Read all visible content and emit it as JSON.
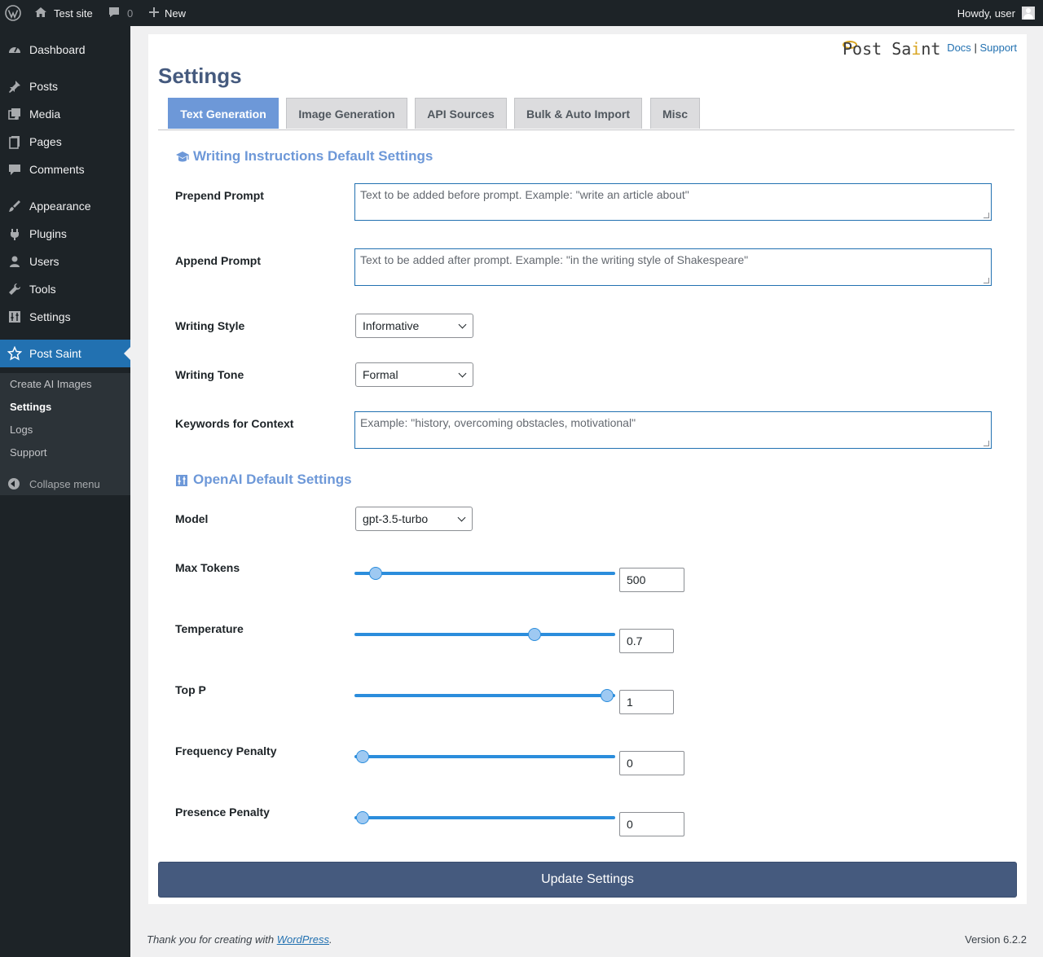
{
  "admin_bar": {
    "site_name": "Test site",
    "comments_count": "0",
    "new_label": "New",
    "howdy": "Howdy, user"
  },
  "sidebar": {
    "items": [
      {
        "label": "Dashboard",
        "icon": "dashboard-icon"
      },
      {
        "label": "Posts",
        "icon": "pin-icon"
      },
      {
        "label": "Media",
        "icon": "media-icon"
      },
      {
        "label": "Pages",
        "icon": "pages-icon"
      },
      {
        "label": "Comments",
        "icon": "comment-icon"
      },
      {
        "label": "Appearance",
        "icon": "brush-icon"
      },
      {
        "label": "Plugins",
        "icon": "plug-icon"
      },
      {
        "label": "Users",
        "icon": "user-icon"
      },
      {
        "label": "Tools",
        "icon": "wrench-icon"
      },
      {
        "label": "Settings",
        "icon": "sliders-icon"
      },
      {
        "label": "Post Saint",
        "icon": "star-icon"
      }
    ],
    "submenu": [
      "Create AI Images",
      "Settings",
      "Logs",
      "Support"
    ],
    "collapse": "Collapse menu"
  },
  "header": {
    "logo_a": "Post Sa",
    "logo_b": "i",
    "logo_c": "nt",
    "docs": "Docs",
    "sep": "|",
    "support": "Support",
    "title": "Settings"
  },
  "tabs": [
    "Text Generation",
    "Image Generation",
    "API Sources",
    "Bulk & Auto Import",
    "Misc"
  ],
  "writing": {
    "heading": "Writing Instructions Default Settings",
    "prepend_label": "Prepend Prompt",
    "prepend_placeholder": "Text to be added before prompt. Example: \"write an article about\"",
    "append_label": "Append Prompt",
    "append_placeholder": "Text to be added after prompt. Example: \"in the writing style of Shakespeare\"",
    "style_label": "Writing Style",
    "style_value": "Informative",
    "tone_label": "Writing Tone",
    "tone_value": "Formal",
    "keywords_label": "Keywords for Context",
    "keywords_placeholder": "Example: \"history, overcoming obstacles, motivational\""
  },
  "openai": {
    "heading": "OpenAI Default Settings",
    "model_label": "Model",
    "model_value": "gpt-3.5-turbo",
    "max_tokens_label": "Max Tokens",
    "max_tokens_value": "500",
    "max_tokens_fraction": 0.08,
    "temperature_label": "Temperature",
    "temperature_value": "0.7",
    "temperature_fraction": 0.69,
    "top_p_label": "Top P",
    "top_p_value": "1",
    "top_p_fraction": 0.97,
    "frequency_label": "Frequency Penalty",
    "frequency_value": "0",
    "frequency_fraction": 0.03,
    "presence_label": "Presence Penalty",
    "presence_value": "0",
    "presence_fraction": 0.03
  },
  "update_button": "Update Settings",
  "footer": {
    "thanks_prefix": "Thank you for creating with ",
    "thanks_link": "WordPress",
    "thanks_suffix": ".",
    "version": "Version 6.2.2"
  }
}
